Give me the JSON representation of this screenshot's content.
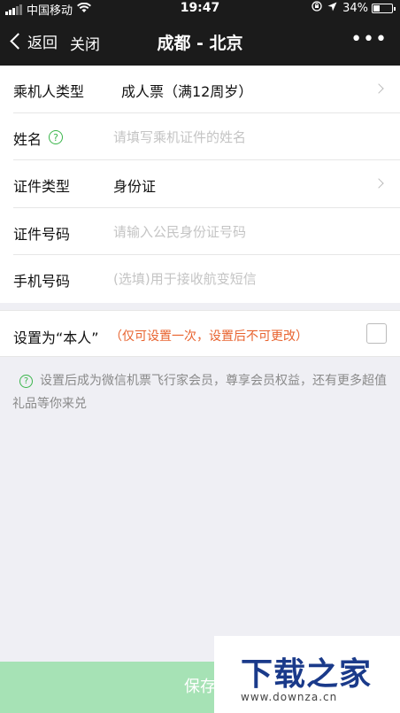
{
  "status_bar": {
    "carrier": "中国移动",
    "time": "19:47",
    "battery": "34%",
    "battery_level": 0.34
  },
  "nav": {
    "back_label": "返回",
    "close_label": "关闭",
    "title": "成都 - 北京",
    "more_label": "•••"
  },
  "form": {
    "passenger_type": {
      "label": "乘机人类型",
      "value": "成人票（满12周岁）"
    },
    "name": {
      "label": "姓名",
      "placeholder": "请填写乘机证件的姓名"
    },
    "id_type": {
      "label": "证件类型",
      "value": "身份证"
    },
    "id_number": {
      "label": "证件号码",
      "placeholder": "请输入公民身份证号码"
    },
    "phone": {
      "label": "手机号码",
      "placeholder": "(选填)用于接收航变短信"
    }
  },
  "self_setting": {
    "label": "设置为“本人”",
    "note": "（仅可设置一次，设置后不可更改）"
  },
  "tip": {
    "text": "设置后成为微信机票飞行家会员，尊享会员权益，还有更多超值礼品等你来兑"
  },
  "save_button": {
    "label": "保存"
  },
  "watermark": {
    "logo": "下载之家",
    "url": "www.downza.cn"
  }
}
